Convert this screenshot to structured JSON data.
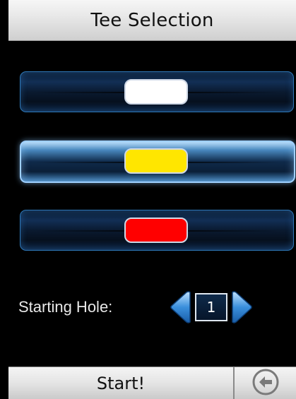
{
  "header": {
    "title": "Tee Selection"
  },
  "tees": [
    {
      "color_name": "white-tee",
      "color": "#ffffff",
      "selected": false
    },
    {
      "color_name": "yellow-tee",
      "color": "#ffe600",
      "selected": true
    },
    {
      "color_name": "red-tee",
      "color": "#ff0000",
      "selected": false
    }
  ],
  "starting_hole": {
    "label": "Starting Hole:",
    "value": "1",
    "prev_icon": "left-arrow-icon",
    "next_icon": "right-arrow-icon"
  },
  "footer": {
    "start_label": "Start!",
    "back_icon": "back-arrow-icon"
  },
  "colors": {
    "accent_blue": "#2e78b8",
    "arrow_blue": "#4aa0e8",
    "bar_light": "#e8e8e8"
  }
}
